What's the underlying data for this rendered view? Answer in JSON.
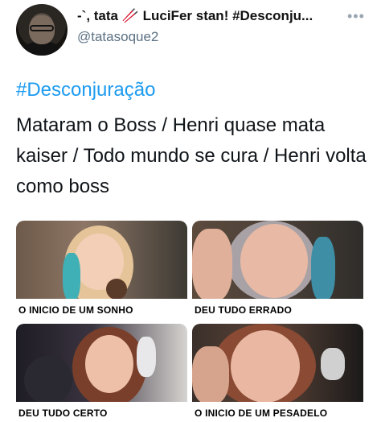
{
  "header": {
    "display_name": "-`, tata 🥢 LuciFer stan! #Desconju...",
    "handle": "@tatasoque2",
    "more_icon": "more-icon"
  },
  "tweet": {
    "hashtag": "#Desconjuração",
    "text": "Mataram o Boss / Henri quase mata kaiser / Todo mundo se cura / Henri volta como boss"
  },
  "meme": {
    "panels": [
      {
        "caption": "O INICIO DE UM SONHO"
      },
      {
        "caption": "DEU TUDO ERRADO"
      },
      {
        "caption_a": "DEU TUDO ",
        "caption_b": "CERTO"
      },
      {
        "caption_a": "O INICIO DE UM ",
        "caption_b": "PESADELO"
      }
    ]
  },
  "colors": {
    "accent": "#1d9bf0",
    "handle": "#5b7083"
  }
}
